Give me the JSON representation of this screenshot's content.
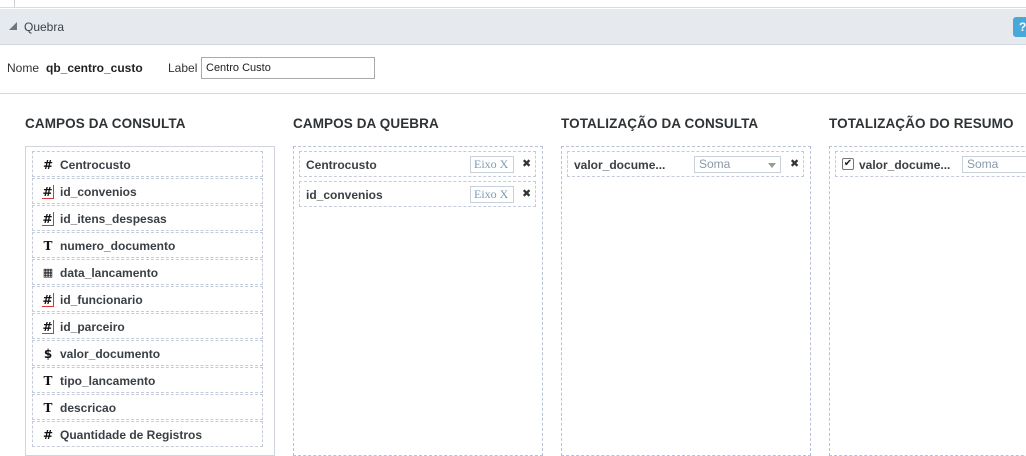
{
  "section": {
    "title": "Quebra",
    "help": "?"
  },
  "form": {
    "nome_label": "Nome",
    "nome_value": "qb_centro_custo",
    "label_label": "Label",
    "label_value": "Centro Custo"
  },
  "columns": {
    "consulta": "CAMPOS DA CONSULTA",
    "quebra": "CAMPOS DA QUEBRA",
    "totalizacao_consulta": "TOTALIZAÇÃO DA CONSULTA",
    "totalizacao_resumo": "TOTALIZAÇÃO DO RESUMO"
  },
  "fields": [
    {
      "name": "Centrocusto",
      "icon": "#",
      "icon_name": "number-icon"
    },
    {
      "name": "id_convenios",
      "icon": "#",
      "icon_name": "key-number-icon"
    },
    {
      "name": "id_itens_despesas",
      "icon": "#",
      "icon_name": "key-number-icon"
    },
    {
      "name": "numero_documento",
      "icon": "T",
      "icon_name": "text-icon"
    },
    {
      "name": "data_lancamento",
      "icon": "▦",
      "icon_name": "calendar-icon"
    },
    {
      "name": "id_funcionario",
      "icon": "#",
      "icon_name": "key-number-icon"
    },
    {
      "name": "id_parceiro",
      "icon": "#",
      "icon_name": "key-number-icon"
    },
    {
      "name": "valor_documento",
      "icon": "$",
      "icon_name": "currency-icon"
    },
    {
      "name": "tipo_lancamento",
      "icon": "T",
      "icon_name": "text-icon"
    },
    {
      "name": "descricao",
      "icon": "T",
      "icon_name": "text-icon"
    },
    {
      "name": "Quantidade de Registros",
      "icon": "#",
      "icon_name": "number-icon"
    }
  ],
  "break_fields": [
    {
      "name": "Centrocusto",
      "axis": "Eixo X",
      "remove": "✖"
    },
    {
      "name": "id_convenios",
      "axis": "Eixo X",
      "remove": "✖"
    }
  ],
  "totals_consulta": [
    {
      "name": "valor_docume...",
      "function": "Soma",
      "remove": "✖"
    }
  ],
  "totals_resumo": [
    {
      "name": "valor_docume...",
      "function": "Soma",
      "checked": "✔"
    }
  ]
}
